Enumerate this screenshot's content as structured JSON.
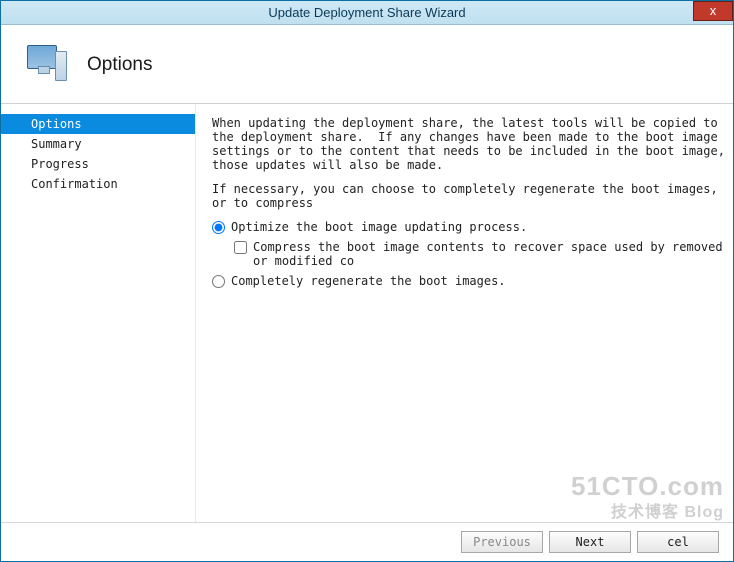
{
  "window": {
    "title": "Update Deployment Share Wizard",
    "close": "x"
  },
  "header": {
    "page_title": "Options"
  },
  "sidebar": {
    "items": [
      {
        "label": "Options",
        "active": true
      },
      {
        "label": "Summary",
        "active": false
      },
      {
        "label": "Progress",
        "active": false
      },
      {
        "label": "Confirmation",
        "active": false
      }
    ]
  },
  "main": {
    "description1": "When updating the deployment share, the latest tools will be copied to the deployment share.  If any changes have been made to the boot image settings or to the content that needs to be included in the boot image, those updates will also be made.",
    "description2": "If necessary, you can choose to completely regenerate the boot images, or to compress",
    "option_optimize": "Optimize the boot image updating process.",
    "option_compress": "Compress the boot image contents to recover space used by removed or modified co",
    "option_regenerate": "Completely regenerate the boot images."
  },
  "footer": {
    "previous": "Previous",
    "next": "Next",
    "cancel": "cel"
  },
  "watermark": {
    "main": "51CTO.com",
    "sub": "技术博客   Blog"
  }
}
